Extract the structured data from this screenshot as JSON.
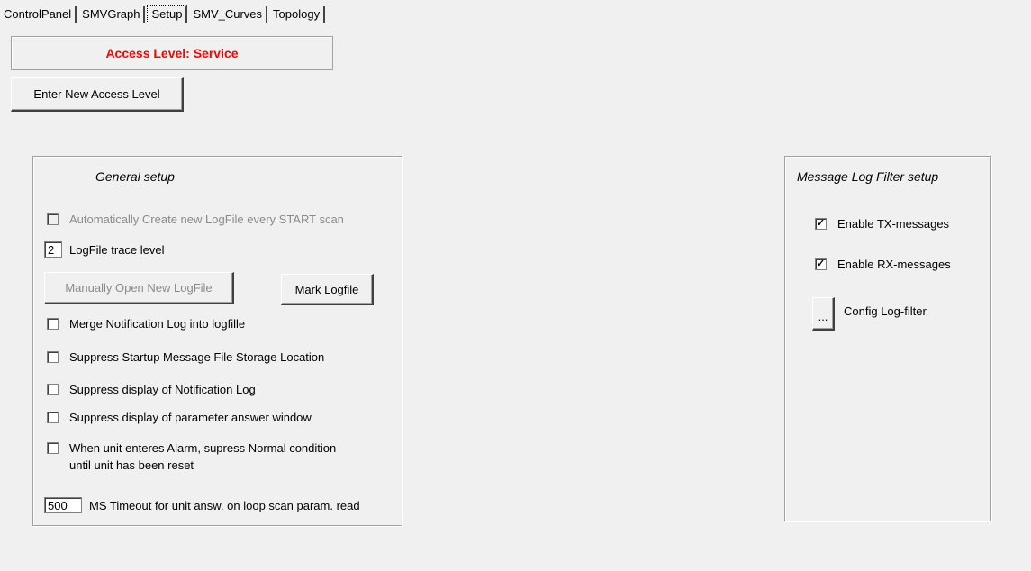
{
  "tabs": [
    {
      "label": "ControlPanel"
    },
    {
      "label": "SMVGraph"
    },
    {
      "label": "Setup"
    },
    {
      "label": "SMV_Curves"
    },
    {
      "label": "Topology"
    }
  ],
  "active_tab": "Setup",
  "access": {
    "label": "Access Level: Service",
    "color": "#ff0000",
    "enter_button": "Enter New Access Level"
  },
  "general": {
    "title": "General setup",
    "auto_create": {
      "label": "Automatically Create new LogFile every START scan",
      "checked": false,
      "enabled": false
    },
    "trace_level": {
      "value": "2",
      "label": "LogFile trace level"
    },
    "open_logfile_button": "Manually Open New LogFile",
    "mark_logfile_button": "Mark Logfile",
    "merge_notification": {
      "label": "Merge Notification Log into logfille",
      "checked": false
    },
    "suppress_startup": {
      "label": "Suppress Startup Message File Storage Location",
      "checked": false
    },
    "suppress_notification": {
      "label": "Suppress display of Notification Log",
      "checked": false
    },
    "suppress_param": {
      "label": "Suppress display of parameter answer window",
      "checked": false
    },
    "alarm": {
      "line1": "When unit enteres Alarm, supress Normal condition",
      "line2": "until unit has been reset",
      "checked": false
    },
    "timeout": {
      "value": "500",
      "label": "MS Timeout for unit answ. on loop scan param. read"
    }
  },
  "filter": {
    "title": "Message Log Filter setup",
    "tx": {
      "label": "Enable TX-messages",
      "checked": true
    },
    "rx": {
      "label": "Enable RX-messages",
      "checked": true
    },
    "config_button": "...",
    "config_label": "Config Log-filter"
  }
}
